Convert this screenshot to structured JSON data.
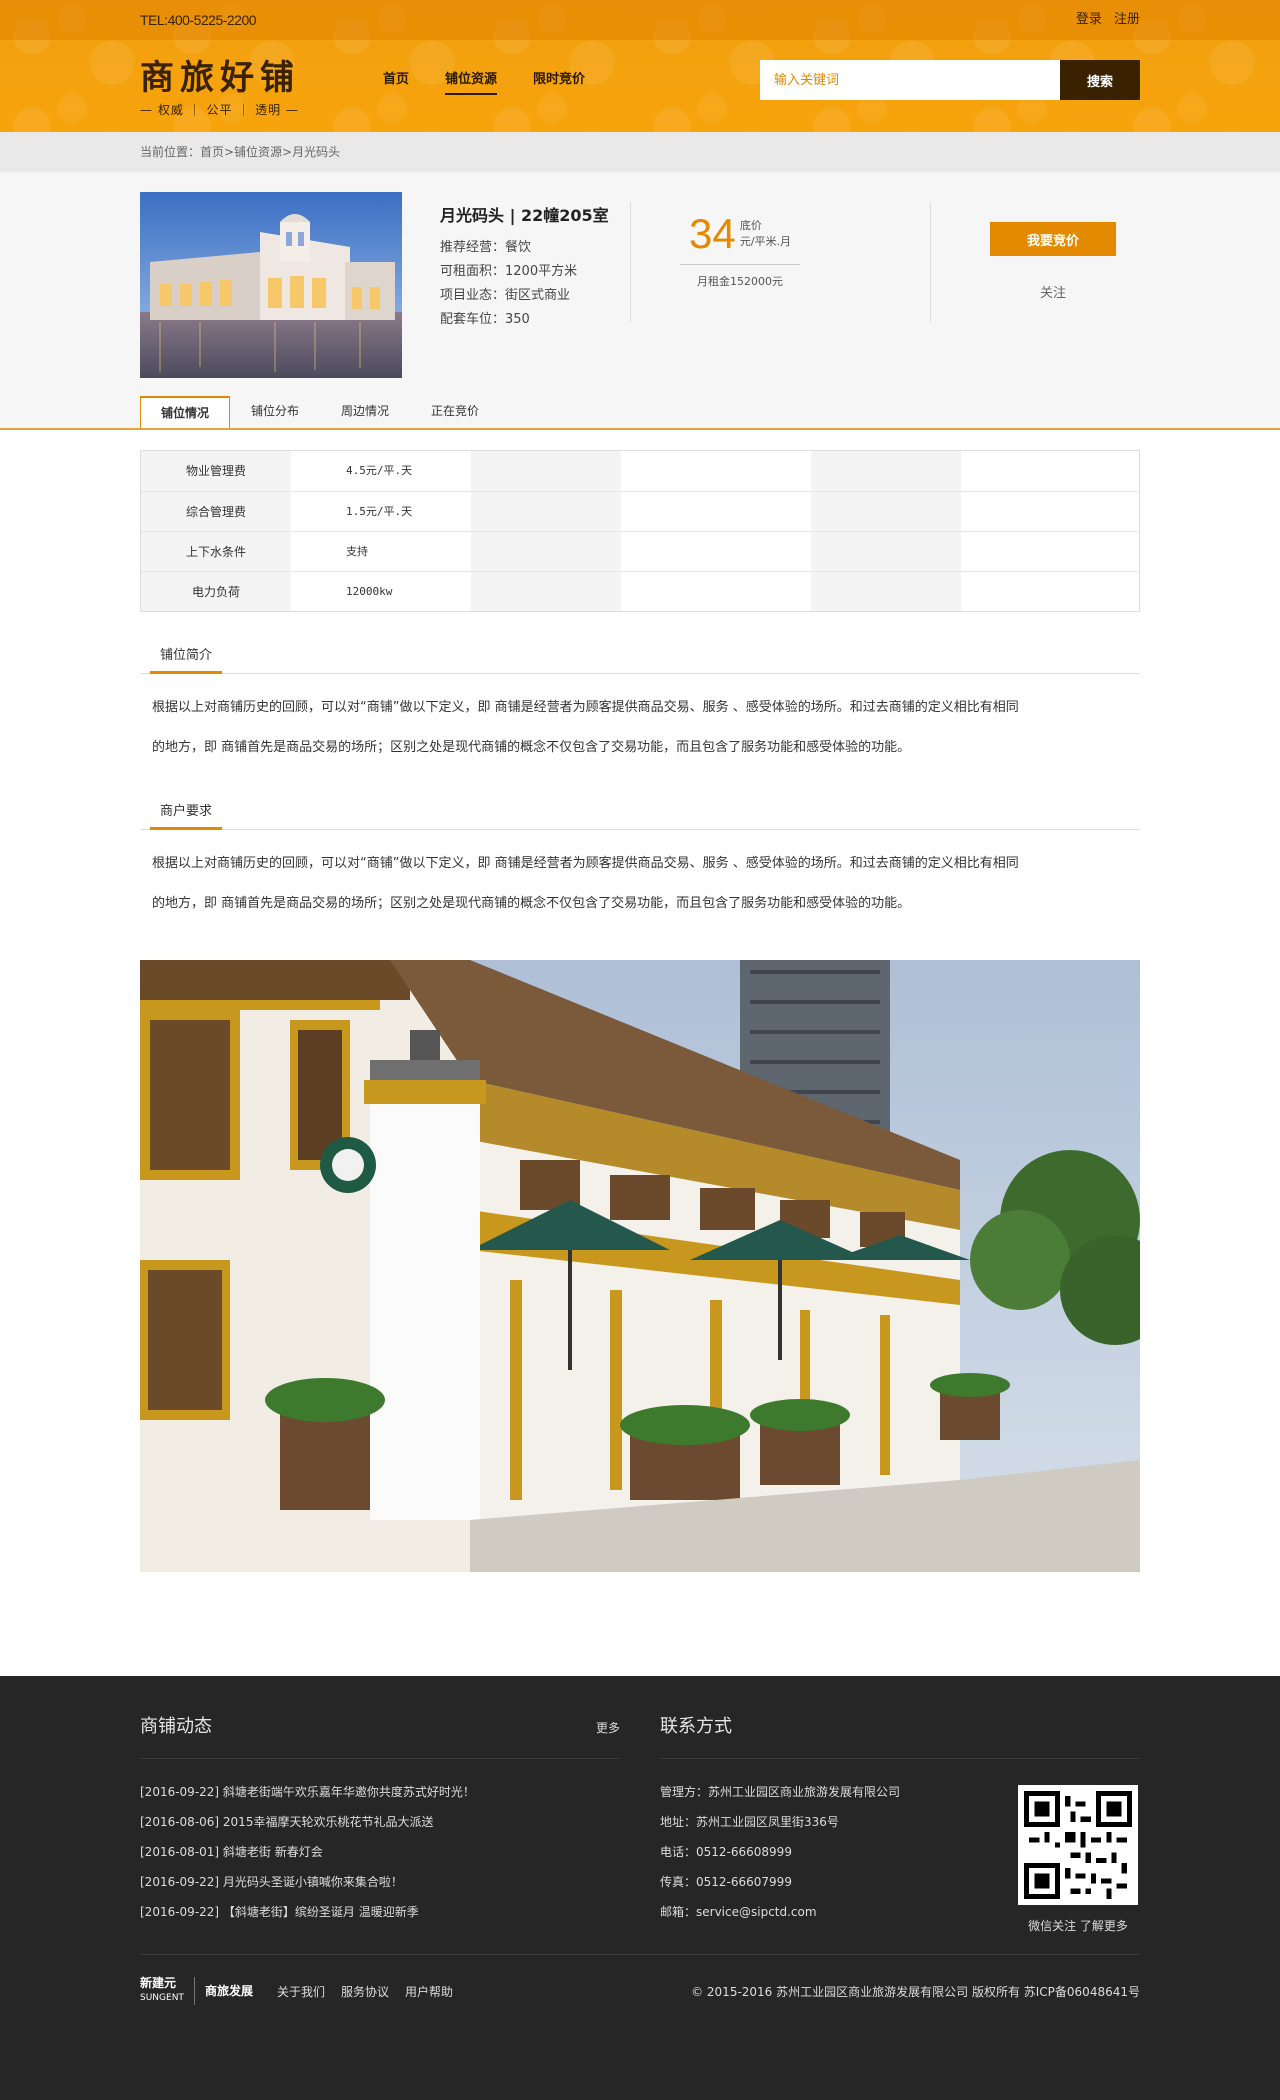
{
  "header": {
    "tel": "TEL:400-5225-2200",
    "login": "登录",
    "register": "注册",
    "logo_title": "商旅好铺",
    "logo_sub": "— 权威 ｜ 公平 ｜ 透明 —",
    "nav": [
      {
        "label": "首页"
      },
      {
        "label": "铺位资源"
      },
      {
        "label": "限时竞价"
      }
    ],
    "search_placeholder": "输入关键词",
    "search_button": "搜索"
  },
  "breadcrumb": "当前位置：首页>铺位资源>月光码头",
  "product": {
    "title": "月光码头 | 22幢205室",
    "rows": [
      "推荐经营：餐饮",
      "可租面积：1200平方米",
      "项目业态：街区式商业",
      "配套车位：350"
    ],
    "price": "34",
    "price_label": "底价",
    "price_unit": "元/平米.月",
    "monthly_rent": "月租金152000元",
    "bid_button": "我要竞价",
    "follow": "关注"
  },
  "tabs": [
    "铺位情况",
    "铺位分布",
    "周边情况",
    "正在竞价"
  ],
  "specs": [
    {
      "label": "物业管理费",
      "value": "4.5元/平.天"
    },
    {
      "label": "综合管理费",
      "value": "1.5元/平.天"
    },
    {
      "label": "上下水条件",
      "value": "支持"
    },
    {
      "label": "电力负荷",
      "value": "12000kw"
    }
  ],
  "sections": [
    {
      "title": "铺位简介",
      "line1": "根据以上对商铺历史的回顾，可以对“商铺”做以下定义，即 商铺是经营者为顾客提供商品交易、服务 、感受体验的场所。和过去商铺的定义相比有相同",
      "line2": "的地方，即 商铺首先是商品交易的场所；区别之处是现代商铺的概念不仅包含了交易功能，而且包含了服务功能和感受体验的功能。"
    },
    {
      "title": "商户要求",
      "line1": "根据以上对商铺历史的回顾，可以对“商铺”做以下定义，即 商铺是经营者为顾客提供商品交易、服务 、感受体验的场所。和过去商铺的定义相比有相同",
      "line2": "的地方，即 商铺首先是商品交易的场所；区别之处是现代商铺的概念不仅包含了交易功能，而且包含了服务功能和感受体验的功能。"
    }
  ],
  "footer": {
    "news_title": "商铺动态",
    "more": "更多",
    "news": [
      "[2016-09-22] 斜塘老街端午欢乐嘉年华邀你共度苏式好时光！",
      "[2016-08-06] 2015幸福摩天轮欢乐桃花节礼品大派送",
      "[2016-08-01] 斜塘老街 新春灯会",
      "[2016-09-22] 月光码头圣诞小镇喊你来集合啦！",
      "[2016-09-22] 【斜塘老街】缤纷圣诞月 温暖迎新季"
    ],
    "contact_title": "联系方式",
    "contact": [
      "管理方：苏州工业园区商业旅游发展有限公司",
      "地址：苏州工业园区凤里街336号",
      "电话：0512-66608999",
      "传真：0512-66607999",
      "邮箱：service@sipctd.com"
    ],
    "qr_caption": "微信关注 了解更多",
    "brand1": "新建元",
    "brand1_en": "SUNGENT",
    "brand2": "商旅发展",
    "links": [
      "关于我们",
      "服务协议",
      "用户帮助"
    ],
    "copyright": "© 2015-2016   苏州工业园区商业旅游发展有限公司 版权所有   苏ICP备06048641号"
  }
}
